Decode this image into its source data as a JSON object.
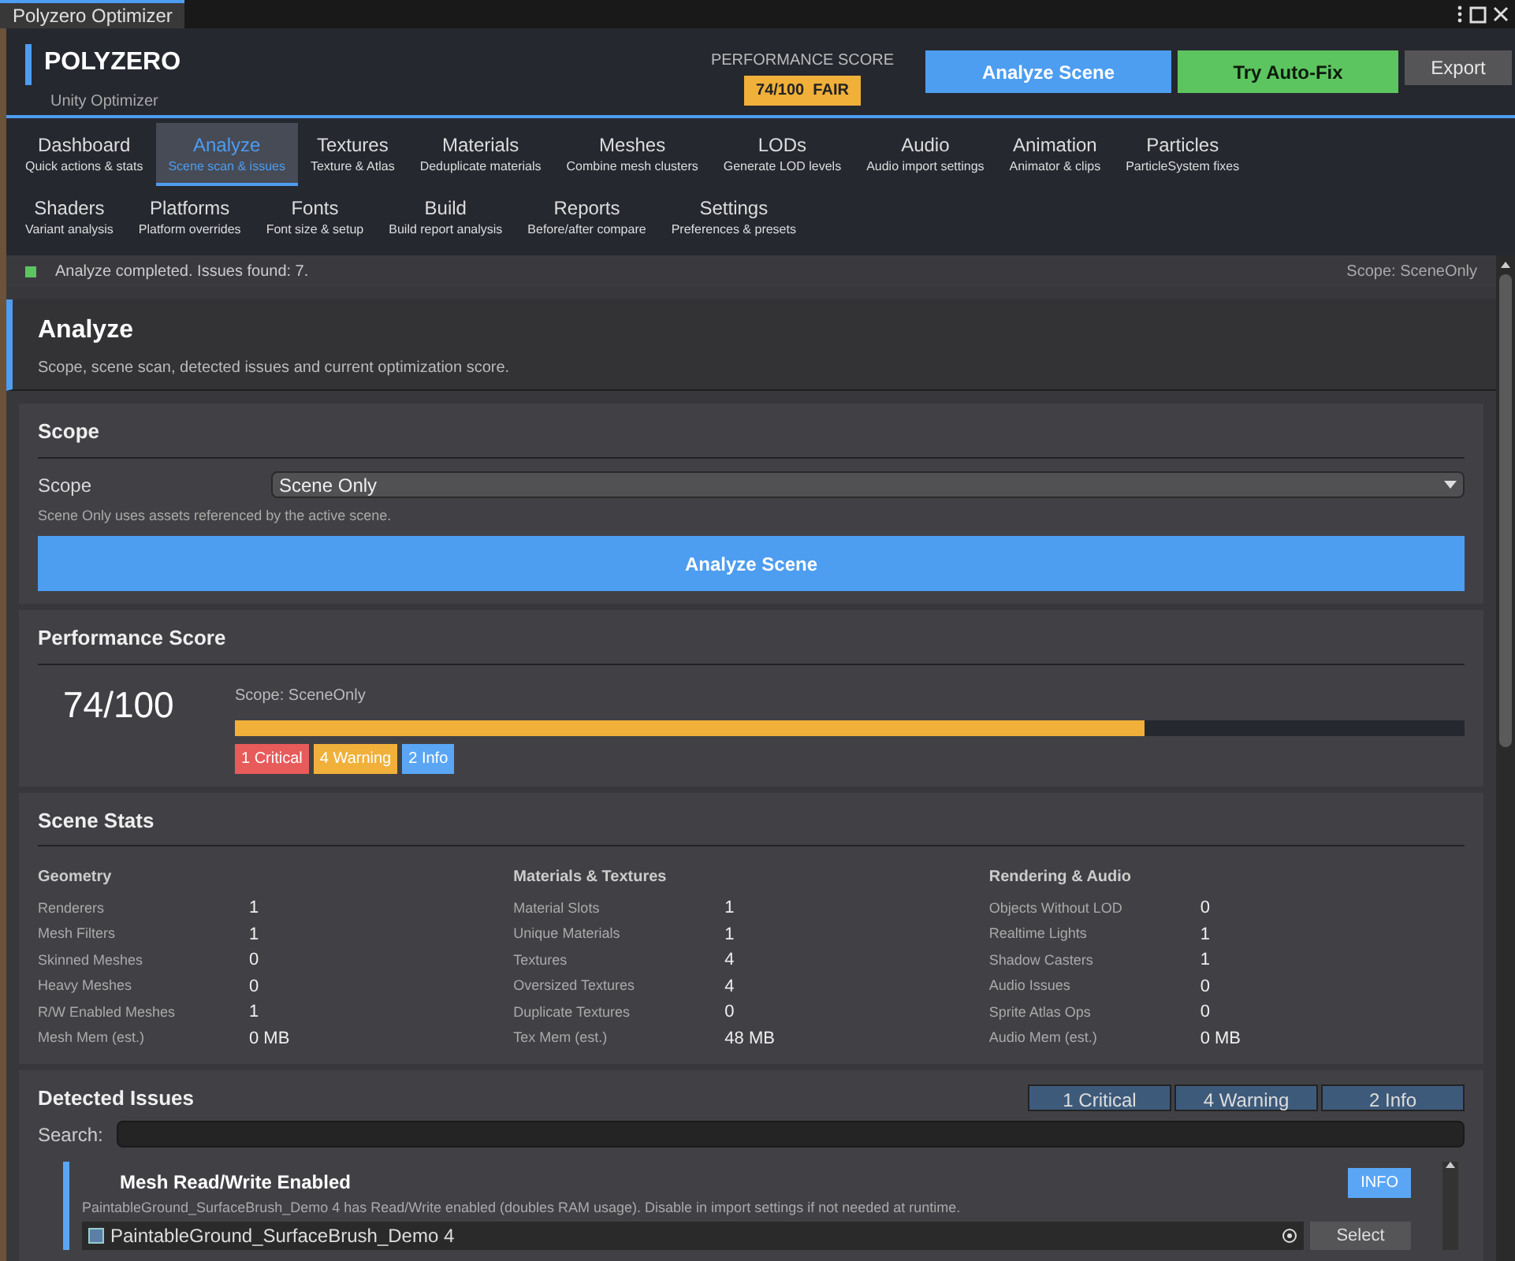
{
  "window": {
    "title": "Polyzero Optimizer"
  },
  "header": {
    "brand": "POLYZERO",
    "subtitle": "Unity Optimizer",
    "score_label": "PERFORMANCE SCORE",
    "score_badge": "74/100  FAIR",
    "buttons": [
      {
        "label": "Analyze Scene",
        "kind": "primary"
      },
      {
        "label": "Try Auto-Fix",
        "kind": "success"
      },
      {
        "label": "Export",
        "kind": "plain"
      }
    ]
  },
  "tabs": [
    {
      "label": "Dashboard",
      "sub": "Quick actions & stats",
      "selected": false
    },
    {
      "label": "Analyze",
      "sub": "Scene scan & issues",
      "selected": true
    },
    {
      "label": "Textures",
      "sub": "Texture & Atlas",
      "selected": false
    },
    {
      "label": "Materials",
      "sub": "Deduplicate materials",
      "selected": false
    },
    {
      "label": "Meshes",
      "sub": "Combine mesh clusters",
      "selected": false
    },
    {
      "label": "LODs",
      "sub": "Generate LOD levels",
      "selected": false
    },
    {
      "label": "Audio",
      "sub": "Audio import settings",
      "selected": false
    },
    {
      "label": "Animation",
      "sub": "Animator & clips",
      "selected": false
    },
    {
      "label": "Particles",
      "sub": "ParticleSystem fixes",
      "selected": false
    },
    {
      "label": "Shaders",
      "sub": "Variant analysis",
      "selected": false
    },
    {
      "label": "Platforms",
      "sub": "Platform overrides",
      "selected": false
    },
    {
      "label": "Fonts",
      "sub": "Font size & setup",
      "selected": false
    },
    {
      "label": "Build",
      "sub": "Build report analysis",
      "selected": false
    },
    {
      "label": "Reports",
      "sub": "Before/after compare",
      "selected": false
    },
    {
      "label": "Settings",
      "sub": "Preferences & presets",
      "selected": false
    }
  ],
  "status_bar": {
    "message": "Analyze completed. Issues found: 7.",
    "scope": "Scope: SceneOnly"
  },
  "page": {
    "title": "Analyze",
    "description": "Scope, scene scan, detected issues and current optimization score."
  },
  "scope": {
    "title": "Scope",
    "label": "Scope",
    "value": "Scene Only",
    "hint": "Scene Only uses assets referenced by the active scene.",
    "button": "Analyze Scene"
  },
  "performance": {
    "title": "Performance Score",
    "score": "74/100",
    "scope": "Scope: SceneOnly",
    "level": 0.74,
    "badges": [
      {
        "label": "1 Critical",
        "color": "#e85b5b"
      },
      {
        "label": "4 Warning",
        "color": "#f0b03a"
      },
      {
        "label": "2 Info",
        "color": "#5aa6f5"
      }
    ]
  },
  "scene_stats": {
    "title": "Scene Stats",
    "groups": [
      {
        "title": "Geometry",
        "rows": [
          {
            "name": "Renderers",
            "value": "1"
          },
          {
            "name": "Mesh Filters",
            "value": "1"
          },
          {
            "name": "Skinned Meshes",
            "value": "0"
          },
          {
            "name": "Heavy Meshes",
            "value": "0"
          },
          {
            "name": "R/W Enabled Meshes",
            "value": "1"
          },
          {
            "name": "Mesh Mem (est.)",
            "value": "0 MB"
          }
        ]
      },
      {
        "title": "Materials & Textures",
        "rows": [
          {
            "name": "Material Slots",
            "value": "1"
          },
          {
            "name": "Unique Materials",
            "value": "1"
          },
          {
            "name": "Textures",
            "value": "4"
          },
          {
            "name": "Oversized Textures",
            "value": "4"
          },
          {
            "name": "Duplicate Textures",
            "value": "0"
          },
          {
            "name": "Tex Mem (est.)",
            "value": "48 MB"
          }
        ]
      },
      {
        "title": "Rendering & Audio",
        "rows": [
          {
            "name": "Objects Without LOD",
            "value": "0"
          },
          {
            "name": "Realtime Lights",
            "value": "1"
          },
          {
            "name": "Shadow Casters",
            "value": "1"
          },
          {
            "name": "Audio Issues",
            "value": "0"
          },
          {
            "name": "Sprite Atlas Ops",
            "value": "0"
          },
          {
            "name": "Audio Mem (est.)",
            "value": "0 MB"
          }
        ]
      }
    ]
  },
  "issues": {
    "title": "Detected Issues",
    "filters": [
      "1 Critical",
      "4 Warning",
      "2 Info"
    ],
    "search_label": "Search:",
    "items": [
      {
        "title": "Mesh Read/Write Enabled",
        "severity": "INFO",
        "color": "#5aa6f5",
        "description": "PaintableGround_SurfaceBrush_Demo 4 has Read/Write enabled (doubles RAM usage). Disable in import settings if not needed at runtime.",
        "object": "PaintableGround_SurfaceBrush_Demo 4",
        "action": "Select"
      }
    ]
  }
}
